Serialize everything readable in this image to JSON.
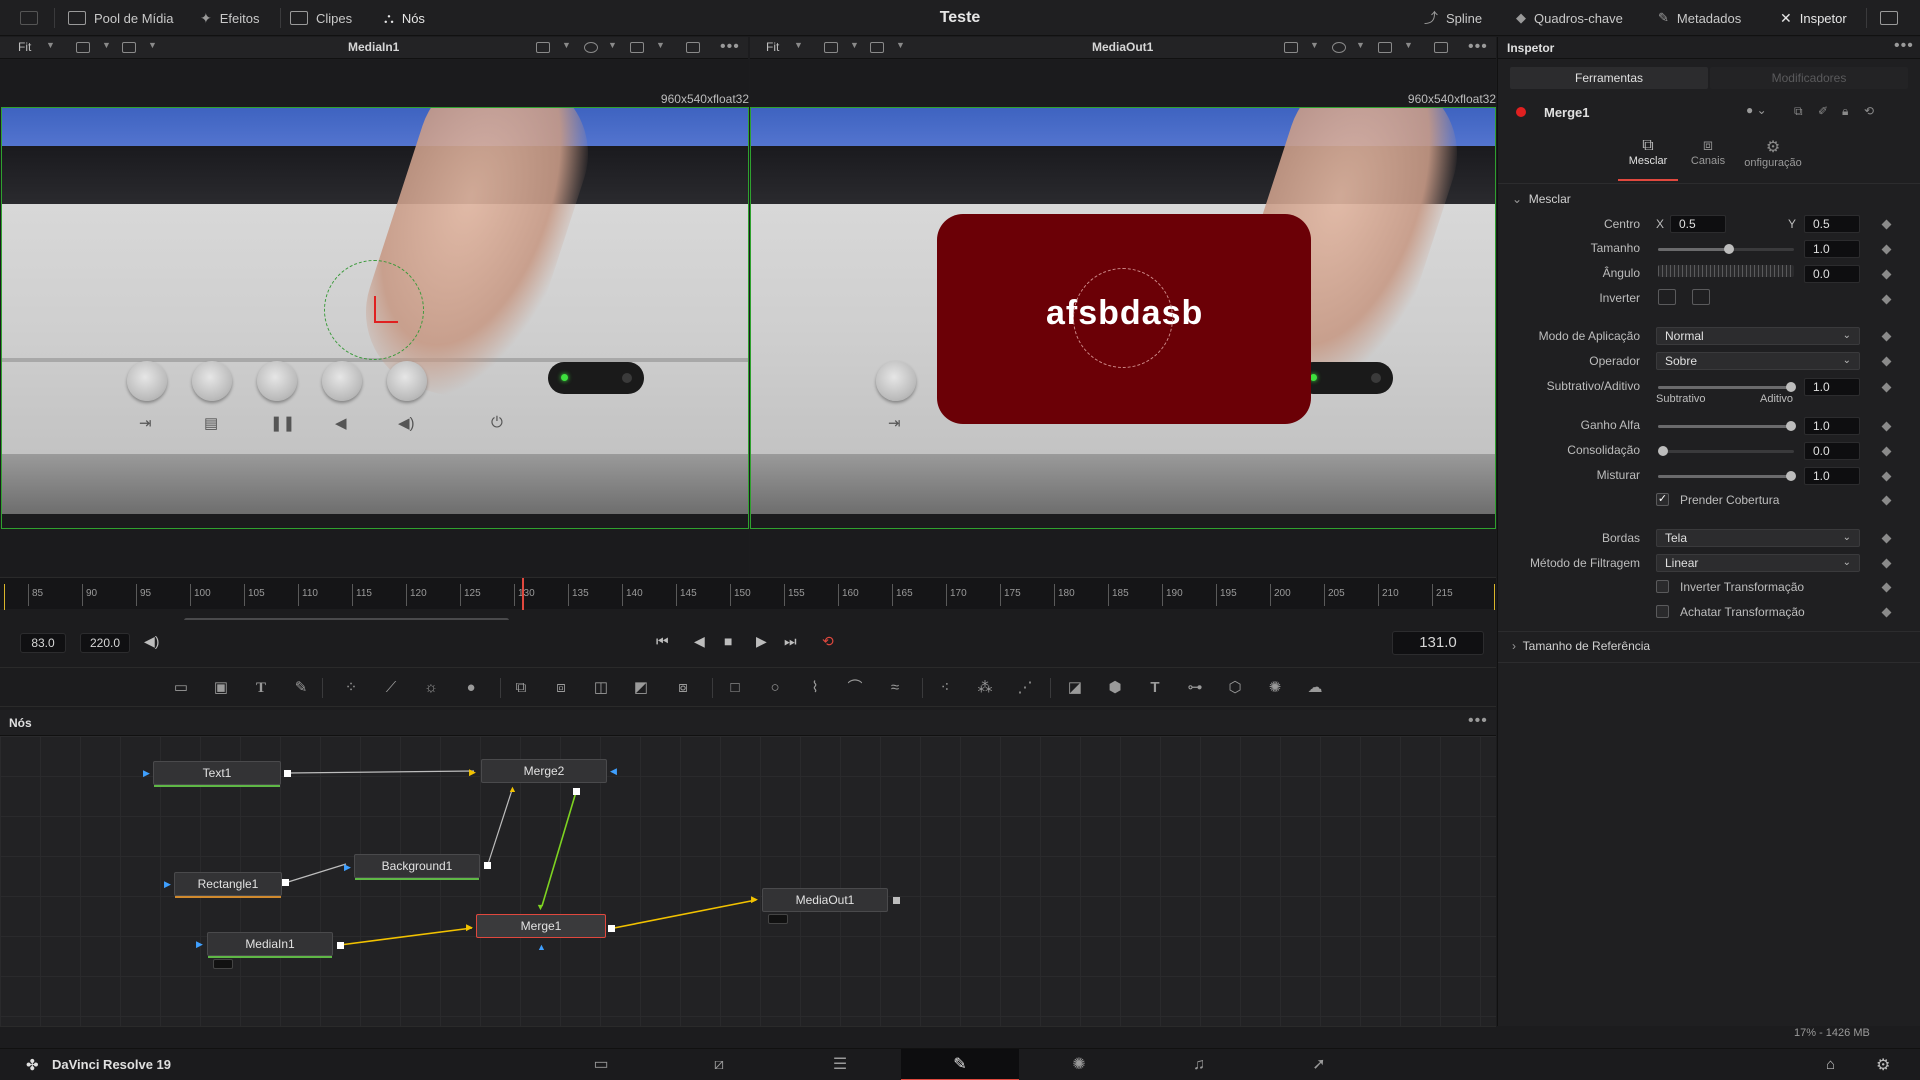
{
  "topbar": {
    "media_pool": "Pool de Mídia",
    "effects": "Efeitos",
    "clips": "Clipes",
    "nodes": "Nós",
    "title": "Teste",
    "spline": "Spline",
    "keyframes": "Quadros-chave",
    "metadata": "Metadados",
    "inspector": "Inspetor"
  },
  "viewers": {
    "left": {
      "fit": "Fit",
      "name": "MediaIn1",
      "resolution": "960x540xfloat32"
    },
    "right": {
      "fit": "Fit",
      "name": "MediaOut1",
      "resolution": "960x540xfloat32",
      "overlay_text": "afsbdasb"
    }
  },
  "timeline": {
    "ticks": [
      "85",
      "90",
      "95",
      "100",
      "105",
      "110",
      "115",
      "120",
      "125",
      "130",
      "135",
      "140",
      "145",
      "150",
      "155",
      "160",
      "165",
      "170",
      "175",
      "180",
      "185",
      "190",
      "195",
      "200",
      "205",
      "210",
      "215"
    ],
    "start": "83.0",
    "end": "220.0",
    "current": "131.0"
  },
  "nodes_panel": {
    "title": "Nós",
    "nodes": {
      "text1": "Text1",
      "merge2": "Merge2",
      "rectangle1": "Rectangle1",
      "background1": "Background1",
      "mediain1": "MediaIn1",
      "merge1": "Merge1",
      "mediaout1": "MediaOut1"
    }
  },
  "inspector": {
    "title": "Inspetor",
    "tab_tools": "Ferramentas",
    "tab_modifiers": "Modificadores",
    "node_name": "Merge1",
    "subtab_merge": "Mesclar",
    "subtab_channels": "Canais",
    "subtab_settings": "onfiguração",
    "section_merge": "Mesclar",
    "center_label": "Centro",
    "x_label": "X",
    "center_x": "0.5",
    "y_label": "Y",
    "center_y": "0.5",
    "size_label": "Tamanho",
    "size_value": "1.0",
    "angle_label": "Ângulo",
    "angle_value": "0.0",
    "invert_label": "Inverter",
    "apply_mode_label": "Modo de Aplicação",
    "apply_mode_value": "Normal",
    "operator_label": "Operador",
    "operator_value": "Sobre",
    "sub_add_label": "Subtrativo/Aditivo",
    "sub_add_value": "1.0",
    "subtractive": "Subtrativo",
    "additive": "Aditivo",
    "alpha_gain_label": "Ganho Alfa",
    "alpha_gain_value": "1.0",
    "burn_in_label": "Consolidação",
    "burn_in_value": "0.0",
    "blend_label": "Misturar",
    "blend_value": "1.0",
    "clip_coverage": "Prender Cobertura",
    "edges_label": "Bordas",
    "edges_value": "Tela",
    "filter_method_label": "Método de Filtragem",
    "filter_method_value": "Linear",
    "invert_transform": "Inverter Transformação",
    "flatten_transform": "Achatar Transformação",
    "reference_size": "Tamanho de Referência"
  },
  "status": {
    "memory": "17% - 1426 MB",
    "app_name": "DaVinci Resolve 19"
  }
}
